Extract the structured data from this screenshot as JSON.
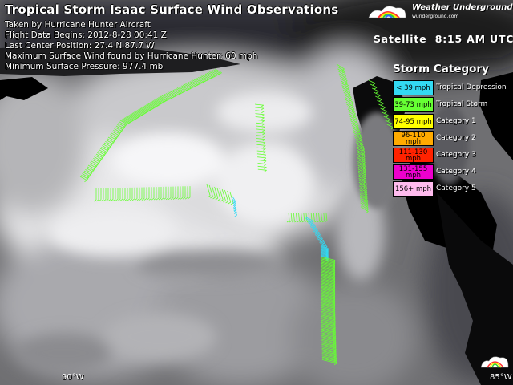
{
  "title": "Tropical Storm Isaac Surface Wind Observations",
  "info_lines": [
    "Taken by Hurricane Hunter Aircraft",
    "Flight Data Begins: 2012-8-28 00:41 Z",
    "Last Center Position: 27.4 N 87.7 W",
    "Maximum Surface Wind found by Hurricane Hunter: 60 mph",
    "Minimum Surface Pressure: 977.4 mb"
  ],
  "brand": {
    "name": "Weather Underground",
    "name_suffix": "®",
    "site": "wunderground.com"
  },
  "satellite": {
    "label": "Satellite",
    "time": "8:15 AM UTC"
  },
  "legend": {
    "title": "Storm Category",
    "items": [
      {
        "range": "< 39 mph",
        "name": "Tropical Depression",
        "color": "#33d9f2"
      },
      {
        "range": "39-73 mph",
        "name": "Tropical Storm",
        "color": "#66ff33"
      },
      {
        "range": "74-95 mph",
        "name": "Category 1",
        "color": "#ffff00"
      },
      {
        "range": "96-110 mph",
        "name": "Category 2",
        "color": "#ffaa00"
      },
      {
        "range": "111-130 mph",
        "name": "Category 3",
        "color": "#ff2200"
      },
      {
        "range": "131-155 mph",
        "name": "Category 4",
        "color": "#ee00cc"
      },
      {
        "range": "156+ mph",
        "name": "Category 5",
        "color": "#ffbbee"
      }
    ]
  },
  "longitude_labels": [
    "90°W",
    "85°W"
  ],
  "colors": {
    "tropical_storm_barb": "#66ff33",
    "depression_barb": "#33d9f2",
    "land": "#000000"
  }
}
